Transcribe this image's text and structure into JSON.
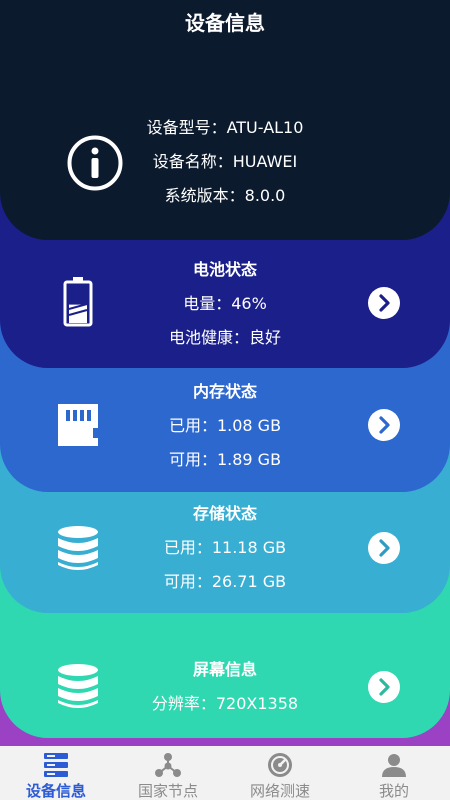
{
  "header": {
    "title": "设备信息"
  },
  "device": {
    "model": "设备型号：ATU-AL10",
    "name": "设备名称：HUAWEI",
    "version": "系统版本：8.0.0",
    "icon": "info-icon"
  },
  "battery": {
    "title": "电池状态",
    "level": "电量：46%",
    "health": "电池健康：良好",
    "level_value": 0.46,
    "icon": "battery-icon"
  },
  "memory": {
    "title": "内存状态",
    "used": "已用：1.08 GB",
    "available": "可用：1.89 GB",
    "icon": "sd-card-icon"
  },
  "storage": {
    "title": "存储状态",
    "used": "已用：11.18 GB",
    "available": "可用：26.71 GB",
    "icon": "database-icon"
  },
  "screen": {
    "title": "屏幕信息",
    "resolution": "分辨率：720X1358",
    "icon": "database-icon"
  },
  "tabs": [
    {
      "label": "设备信息",
      "icon": "device-info-icon",
      "active": true
    },
    {
      "label": "国家节点",
      "icon": "nodes-icon",
      "active": false
    },
    {
      "label": "网络测速",
      "icon": "speed-test-icon",
      "active": false
    },
    {
      "label": "我的",
      "icon": "user-icon",
      "active": false
    }
  ],
  "colors": {
    "device_card": "#0c1a2e",
    "battery_card": "#1a1f8a",
    "memory_card": "#2d68cf",
    "storage_card": "#38aed2",
    "screen_card": "#2fd8b1",
    "bottom_band": "#9b41c4",
    "tab_active": "#2c5bd6",
    "tab_inactive": "#8b8b8b"
  }
}
